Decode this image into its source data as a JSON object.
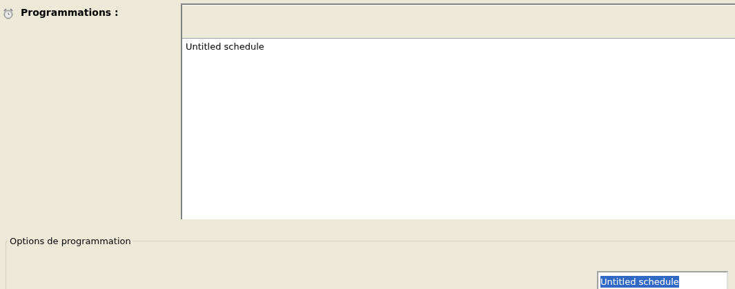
{
  "schedules": {
    "label": "Programmations :",
    "items": [
      {
        "name": "Untitled schedule",
        "selected": false
      }
    ]
  },
  "options": {
    "legend": "Options de programmation",
    "name_field": {
      "value": "Untitled schedule",
      "text_selected": true
    }
  }
}
